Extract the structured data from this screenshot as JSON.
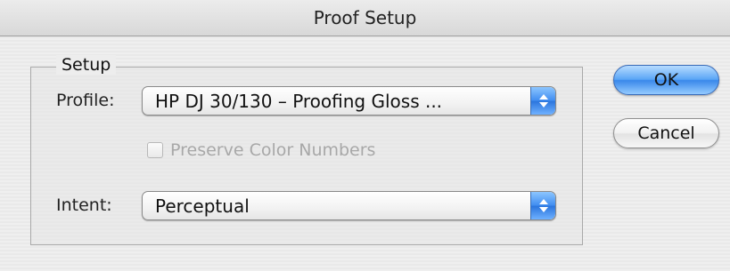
{
  "window": {
    "title": "Proof Setup"
  },
  "setup_group": {
    "legend": "Setup",
    "profile": {
      "label": "Profile:",
      "selected": "HP DJ 30/130 – Proofing Gloss ..."
    },
    "preserve_color_numbers": {
      "label": "Preserve Color Numbers",
      "checked": false,
      "enabled": false
    },
    "intent": {
      "label": "Intent:",
      "selected": "Perceptual"
    }
  },
  "buttons": {
    "ok_label": "OK",
    "cancel_label": "Cancel"
  },
  "colors": {
    "accent": "#3a88ea",
    "disabled_text": "#a8a8a8"
  }
}
